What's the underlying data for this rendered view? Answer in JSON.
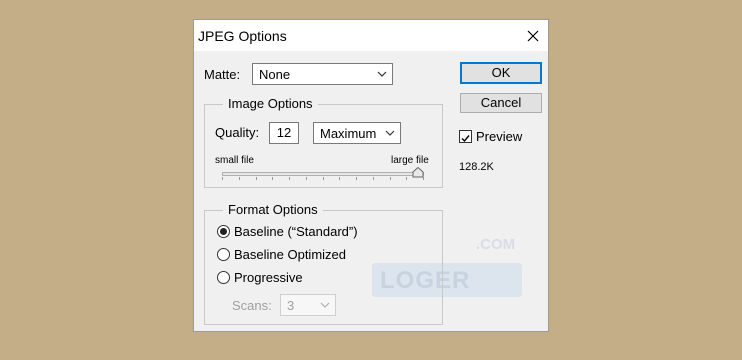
{
  "dialog": {
    "title": "JPEG Options",
    "close_icon": "close-icon",
    "matte": {
      "label": "Matte:",
      "value": "None"
    },
    "image_options": {
      "legend": "Image Options",
      "quality_label": "Quality:",
      "quality_value": "12",
      "quality_preset": "Maximum",
      "slider_min_label": "small file",
      "slider_max_label": "large file",
      "slider_level": 1.0
    },
    "format_options": {
      "legend": "Format Options",
      "options": [
        {
          "label": "Baseline (“Standard”)",
          "checked": true
        },
        {
          "label": "Baseline Optimized",
          "checked": false
        },
        {
          "label": "Progressive",
          "checked": false
        }
      ],
      "scans_label": "Scans:",
      "scans_value": "3"
    },
    "buttons": {
      "ok": "OK",
      "cancel": "Cancel"
    },
    "preview": {
      "label": "Preview",
      "checked": true
    },
    "file_size": "128.2K",
    "watermark": {
      "dot_com": ".COM",
      "text": "LOGER"
    }
  },
  "colors": {
    "background": "#c4ae88",
    "dialog": "#f0f0f0",
    "accent": "#0078d7"
  }
}
